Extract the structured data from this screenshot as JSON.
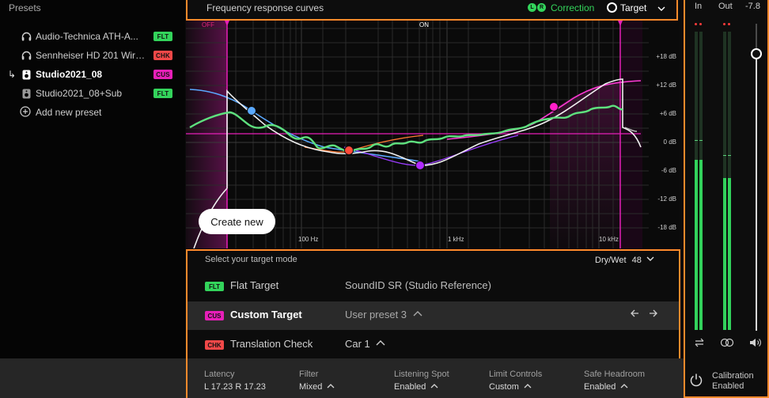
{
  "presets": {
    "title": "Presets",
    "items": [
      {
        "label": "Audio-Technica ATH-A...",
        "badge": "FLT",
        "icon": "headphones-icon",
        "active": false
      },
      {
        "label": "Sennheiser HD 201 Wire...",
        "badge": "CHK",
        "icon": "headphones-icon",
        "active": false
      },
      {
        "label": "Studio2021_08",
        "badge": "CUS",
        "icon": "speaker-icon",
        "active": true,
        "arrow": "↳"
      },
      {
        "label": "Studio2021_08+Sub",
        "badge": "FLT",
        "icon": "speaker-icon",
        "active": false
      }
    ],
    "add_label": "Add new preset"
  },
  "graph": {
    "title": "Frequency response curves",
    "lr": [
      "L",
      "R"
    ],
    "correction_label": "Correction",
    "target_label": "Target",
    "off_label": "OFF",
    "on_label": "ON",
    "db_ticks": [
      "+18 dB",
      "+12 dB",
      "+6 dB",
      "0 dB",
      "-6 dB",
      "-12 dB",
      "-18 dB"
    ],
    "freq_ticks": [
      "100 Hz",
      "1 kHz",
      "10 kHz"
    ],
    "create_new_label": "Create new",
    "colors": {
      "correction": "#33d45b",
      "target": "#ffffff",
      "limit": "#e61fb8",
      "accent": "#ff8a2b"
    }
  },
  "target_mode": {
    "heading": "Select your target mode",
    "drywet_label": "Dry/Wet",
    "drywet_value": "48",
    "rows": [
      {
        "badge": "FLT",
        "name": "Flat Target",
        "value": "SoundID SR (Studio Reference)",
        "selected": false
      },
      {
        "badge": "CUS",
        "name": "Custom Target",
        "value": "User preset 3",
        "selected": true
      },
      {
        "badge": "CHK",
        "name": "Translation Check",
        "value": "Car 1",
        "selected": false
      }
    ]
  },
  "status": [
    {
      "label": "Latency",
      "value": "L 17.23 R 17.23",
      "dropdown": false
    },
    {
      "label": "Filter",
      "value": "Mixed",
      "dropdown": true
    },
    {
      "label": "Listening Spot",
      "value": "Enabled",
      "dropdown": true
    },
    {
      "label": "Limit Controls",
      "value": "Custom",
      "dropdown": true
    },
    {
      "label": "Safe Headroom",
      "value": "Enabled",
      "dropdown": true
    }
  ],
  "meters": {
    "in_label": "In",
    "out_label": "Out",
    "volume_value": "-7.8",
    "in_level": 0.57,
    "out_level": 0.51,
    "calibration_line1": "Calibration",
    "calibration_line2": "Enabled"
  }
}
